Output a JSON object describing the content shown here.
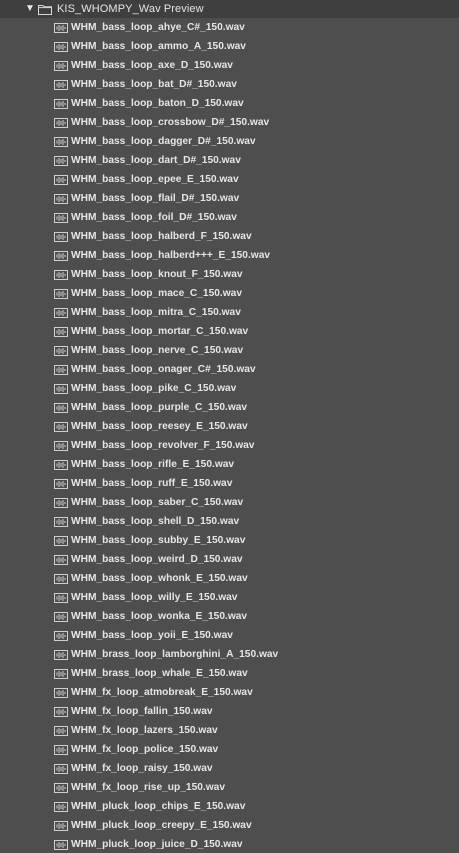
{
  "folder": {
    "expand_glyph": "▼",
    "icon": "folder-icon",
    "label": "KIS_WHOMPY_Wav Preview"
  },
  "file_icon": "audio-file-icon",
  "files": [
    "WHM_bass_loop_ahye_C#_150.wav",
    "WHM_bass_loop_ammo_A_150.wav",
    "WHM_bass_loop_axe_D_150.wav",
    "WHM_bass_loop_bat_D#_150.wav",
    "WHM_bass_loop_baton_D_150.wav",
    "WHM_bass_loop_crossbow_D#_150.wav",
    "WHM_bass_loop_dagger_D#_150.wav",
    "WHM_bass_loop_dart_D#_150.wav",
    "WHM_bass_loop_epee_E_150.wav",
    "WHM_bass_loop_flail_D#_150.wav",
    "WHM_bass_loop_foil_D#_150.wav",
    "WHM_bass_loop_halberd_F_150.wav",
    "WHM_bass_loop_halberd+++_E_150.wav",
    "WHM_bass_loop_knout_F_150.wav",
    "WHM_bass_loop_mace_C_150.wav",
    "WHM_bass_loop_mitra_C_150.wav",
    "WHM_bass_loop_mortar_C_150.wav",
    "WHM_bass_loop_nerve_C_150.wav",
    "WHM_bass_loop_onager_C#_150.wav",
    "WHM_bass_loop_pike_C_150.wav",
    "WHM_bass_loop_purple_C_150.wav",
    "WHM_bass_loop_reesey_E_150.wav",
    "WHM_bass_loop_revolver_F_150.wav",
    "WHM_bass_loop_rifle_E_150.wav",
    "WHM_bass_loop_ruff_E_150.wav",
    "WHM_bass_loop_saber_C_150.wav",
    "WHM_bass_loop_shell_D_150.wav",
    "WHM_bass_loop_subby_E_150.wav",
    "WHM_bass_loop_weird_D_150.wav",
    "WHM_bass_loop_whonk_E_150.wav",
    "WHM_bass_loop_willy_E_150.wav",
    "WHM_bass_loop_wonka_E_150.wav",
    "WHM_bass_loop_yoii_E_150.wav",
    "WHM_brass_loop_lamborghini_A_150.wav",
    "WHM_brass_loop_whale_E_150.wav",
    "WHM_fx_loop_atmobreak_E_150.wav",
    "WHM_fx_loop_fallin_150.wav",
    "WHM_fx_loop_lazers_150.wav",
    "WHM_fx_loop_police_150.wav",
    "WHM_fx_loop_raisy_150.wav",
    "WHM_fx_loop_rise_up_150.wav",
    "WHM_pluck_loop_chips_E_150.wav",
    "WHM_pluck_loop_creepy_E_150.wav",
    "WHM_pluck_loop_juice_D_150.wav"
  ]
}
